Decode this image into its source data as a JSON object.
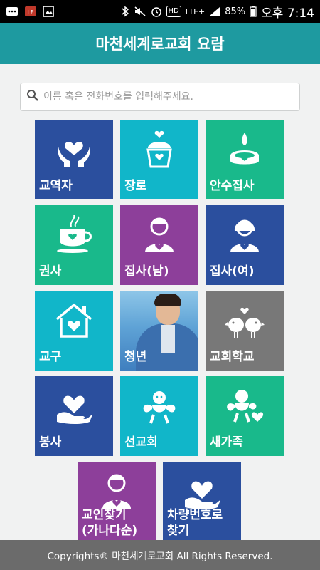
{
  "status": {
    "battery_pct": "85%",
    "time": "오후 7:14",
    "network": "LTE+",
    "hd": "HD"
  },
  "header": {
    "title": "마천세계로교회 요람"
  },
  "search": {
    "placeholder": "이름 혹은 전화번호를 입력해주세요."
  },
  "tiles": [
    {
      "label": "교역자",
      "icon": "hands-heart-icon"
    },
    {
      "label": "장로",
      "icon": "cupcake-heart-icon"
    },
    {
      "label": "안수집사",
      "icon": "candle-icon"
    },
    {
      "label": "권사",
      "icon": "coffee-cup-icon"
    },
    {
      "label": "집사(남)",
      "icon": "man-heart-icon"
    },
    {
      "label": "집사(여)",
      "icon": "woman-heart-icon"
    },
    {
      "label": "교구",
      "icon": "house-heart-icon"
    },
    {
      "label": "청년",
      "icon": "young-man-photo"
    },
    {
      "label": "교회학교",
      "icon": "lovebirds-icon"
    },
    {
      "label": "봉사",
      "icon": "hand-heart-icon"
    },
    {
      "label": "선교회",
      "icon": "angel-icon"
    },
    {
      "label": "새가족",
      "icon": "cherub-heart-icon"
    },
    {
      "label1": "교인찾기",
      "label2": "(가나다순)",
      "icon": "member-search-icon"
    },
    {
      "label1": "차량번호로",
      "label2": "찾기",
      "icon": "car-hand-icon"
    }
  ],
  "footer": {
    "text": "Copyrights® 마천세계로교회 All Rights Reserved."
  },
  "colors": {
    "header": "#1e9aa0",
    "blue": "#2b4f9e",
    "cyan": "#11b6c9",
    "green": "#19b98b",
    "purple": "#8d3f9a",
    "gray": "#787878",
    "footer": "#6b6b6b"
  }
}
